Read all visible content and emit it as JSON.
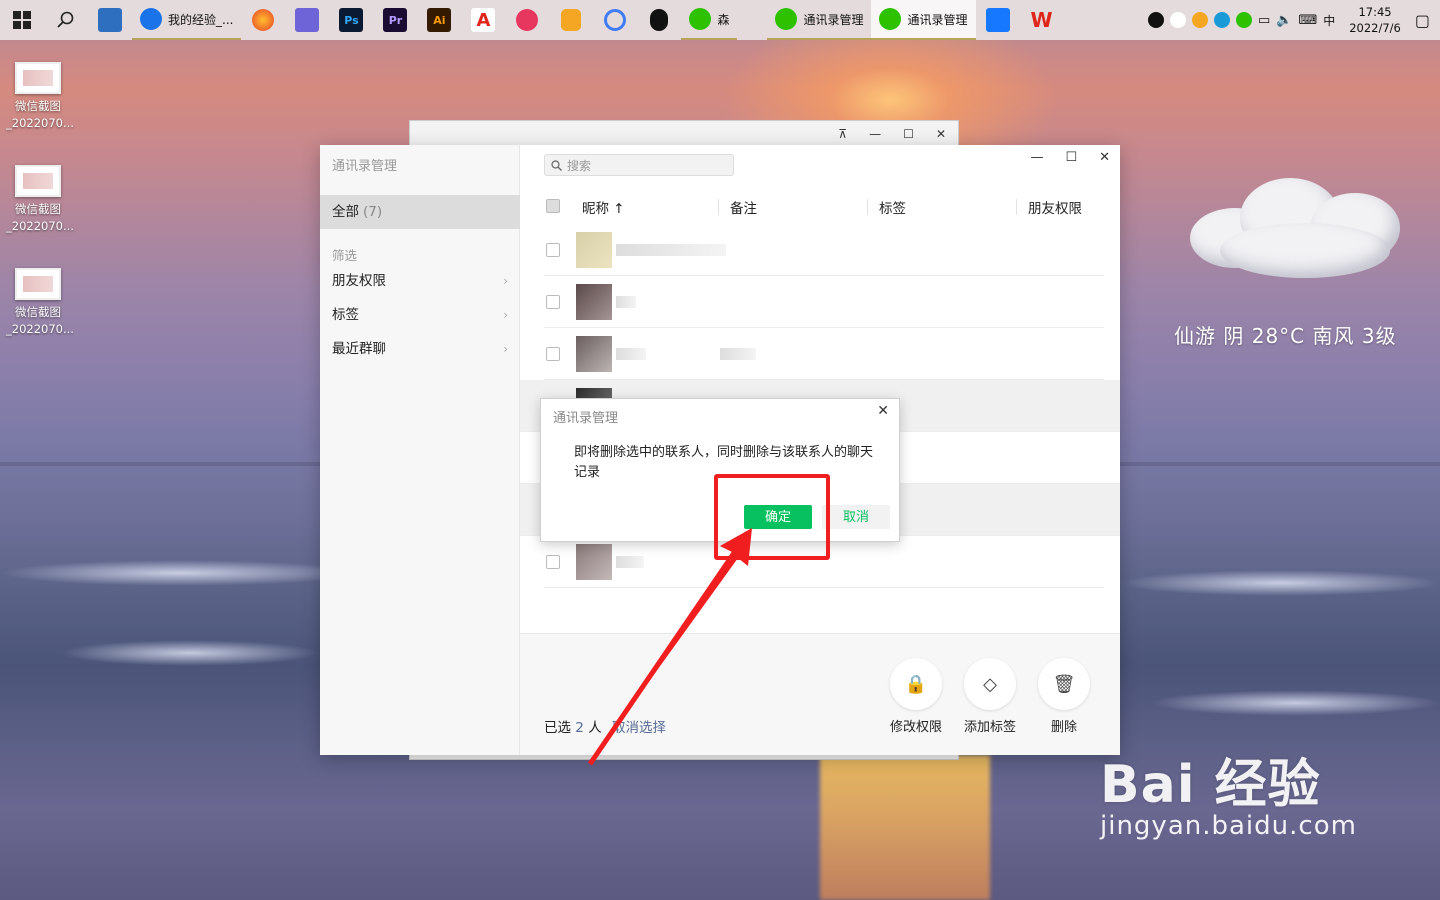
{
  "taskbar": {
    "apps": [
      {
        "label": "我的经验_...",
        "color": "#1a73e8"
      },
      {
        "label": "森",
        "color": "#2dc100"
      },
      {
        "label": "通讯录管理",
        "color": "#2dc100"
      },
      {
        "label": "通讯录管理",
        "color": "#2dc100"
      }
    ],
    "icons": {
      "ps": "Ps",
      "pr": "Pr",
      "ai": "Ai",
      "acrobat": "A"
    },
    "ime": "中",
    "time": "17:45",
    "date": "2022/7/6"
  },
  "desktop": {
    "icons": [
      {
        "line1": "微信截图",
        "line2": "_2022070..."
      },
      {
        "line1": "微信截图",
        "line2": "_2022070..."
      },
      {
        "line1": "微信截图",
        "line2": "_2022070..."
      }
    ],
    "weather": "仙游  阴  28°C  南风  3级"
  },
  "main_window": {
    "title": "通讯录管理",
    "search_placeholder": "搜索",
    "sidebar": {
      "all_label": "全部",
      "all_count": "(7)",
      "filter_label": "筛选",
      "items": [
        "朋友权限",
        "标签",
        "最近群聊"
      ]
    },
    "columns": {
      "nickname": "昵称 ↑",
      "remark": "备注",
      "tag": "标签",
      "permission": "朋友权限"
    },
    "footer": {
      "selected_prefix": "已选",
      "selected_count": "2",
      "selected_suffix": "人",
      "cancel_selection": "取消选择",
      "actions": {
        "permission": "修改权限",
        "add_tag": "添加标签",
        "delete": "删除"
      }
    }
  },
  "dialog": {
    "title": "通讯录管理",
    "message": "即将删除选中的联系人，同时删除与该联系人的聊天记录",
    "ok": "确定",
    "cancel": "取消"
  },
  "watermark": {
    "logo": "Bai 经验",
    "url": "jingyan.baidu.com"
  },
  "colors": {
    "wechat_green": "#07c160",
    "link_blue": "#576b95",
    "annotation_red": "#f01e1e"
  }
}
